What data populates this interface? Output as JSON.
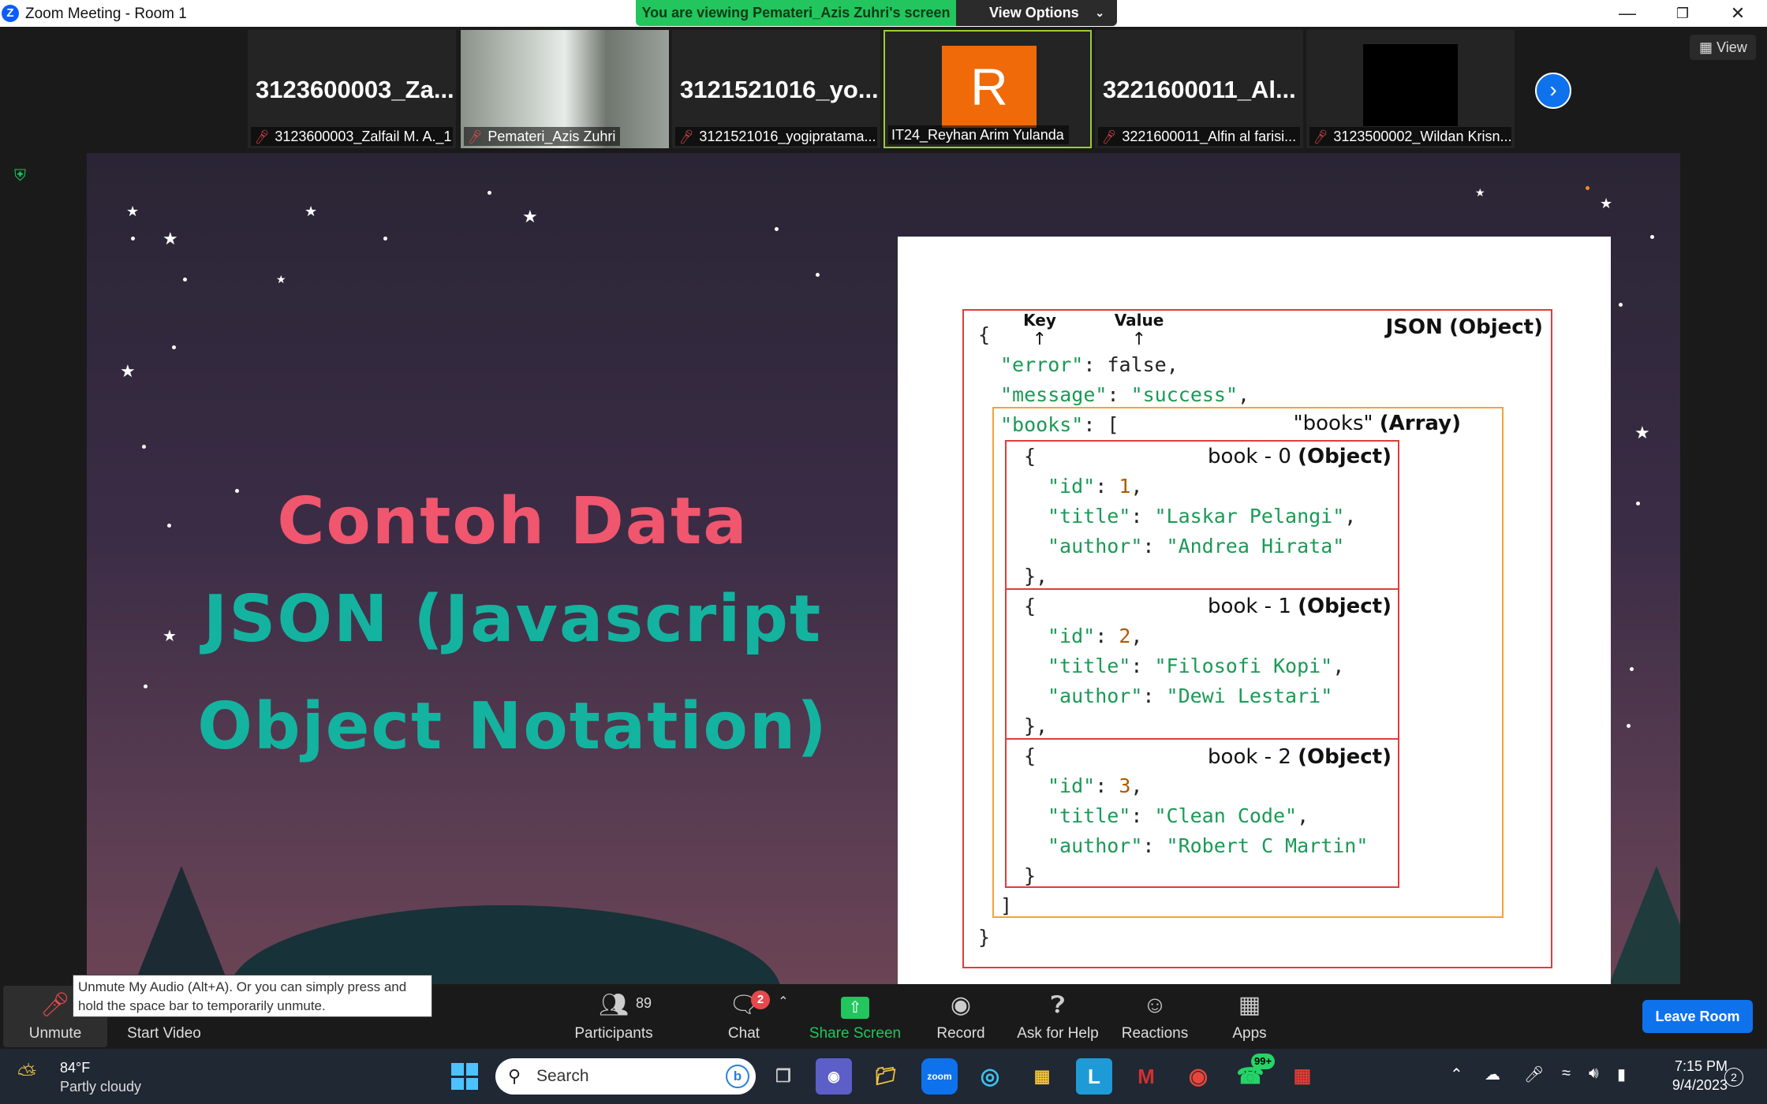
{
  "window": {
    "title": "Zoom Meeting - Room 1",
    "app_icon": "zoom-icon"
  },
  "share_banner": {
    "viewing_text": "You are viewing Pemateri_Azis Zuhri's screen",
    "view_options_label": "View Options"
  },
  "gallery": {
    "view_label": "View",
    "tiles": [
      {
        "big_name": "3123600003_Za...",
        "label": "3123600003_Zalfail M. A._1",
        "muted": true
      },
      {
        "big_name": "",
        "label": "Pemateri_Azis Zuhri",
        "muted": true
      },
      {
        "big_name": "3121521016_yo...",
        "label": "3121521016_yogipratama...",
        "muted": true
      },
      {
        "avatar_letter": "R",
        "label": "IT24_Reyhan Arim Yulanda",
        "muted": false
      },
      {
        "big_name": "3221600011_Al...",
        "label": "3221600011_Alfin al farisi...",
        "muted": true
      },
      {
        "big_name": "",
        "label": "3123500002_Wildan Krisn...",
        "muted": true
      }
    ]
  },
  "slide": {
    "title_line1": "Contoh Data",
    "title_line2": "JSON (Javascript",
    "title_line3": "Object Notation)",
    "key_label": "Key",
    "value_label": "Value",
    "json_object_label": "JSON",
    "json_object_type": "(Object)",
    "books_array_label": "\"books\"",
    "books_array_type": "(Array)",
    "book0_label": "book - 0",
    "book1_label": "book - 1",
    "book2_label": "book - 2",
    "object_type": "(Object)",
    "code": {
      "open_brace": "{",
      "error_line": {
        "key": "\"error\"",
        "value": "false"
      },
      "message_line": {
        "key": "\"message\"",
        "value": "\"success\""
      },
      "books_line": {
        "key": "\"books\"",
        "open": "["
      },
      "books": [
        {
          "id": "1",
          "title": "\"Laskar Pelangi\"",
          "author": "\"Andrea Hirata\""
        },
        {
          "id": "2",
          "title": "\"Filosofi Kopi\"",
          "author": "\"Dewi Lestari\""
        },
        {
          "id": "3",
          "title": "\"Clean Code\"",
          "author": "\"Robert C Martin\""
        }
      ],
      "close_bracket": "]",
      "close_brace": "}"
    }
  },
  "tooltip": "Unmute My Audio (Alt+A). Or you can simply press and hold the space bar to temporarily unmute.",
  "toolbar": {
    "unmute": "Unmute",
    "start_video": "Start Video",
    "participants": "Participants",
    "participants_count": "89",
    "chat": "Chat",
    "chat_badge": "2",
    "share_screen": "Share Screen",
    "record": "Record",
    "ask_for_help": "Ask for Help",
    "reactions": "Reactions",
    "apps": "Apps",
    "leave_room": "Leave Room"
  },
  "taskbar": {
    "temperature": "84°F",
    "condition": "Partly cloudy",
    "search_placeholder": "Search",
    "whatsapp_badge": "99+",
    "time": "7:15 PM",
    "date": "9/4/2023",
    "notification_count": "2"
  },
  "colors": {
    "share_banner": "#22c55e",
    "zoom_blue": "#0e72ed",
    "title_pink": "#f0566e",
    "title_teal": "#14b3a0",
    "box_red": "#e23b3b",
    "box_orange": "#f2a23a"
  }
}
